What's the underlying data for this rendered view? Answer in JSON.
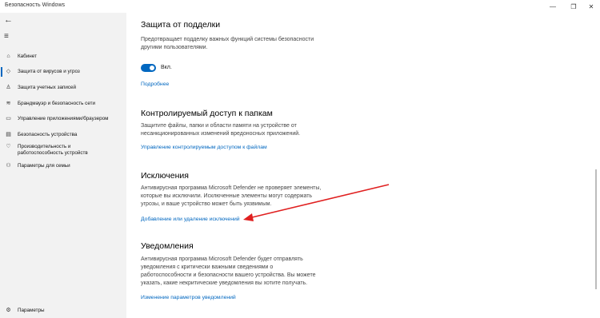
{
  "window": {
    "title": "Безопасность Windows",
    "controls": [
      "—",
      "❐",
      "✕"
    ]
  },
  "sidebar": {
    "back_glyph": "←",
    "menu_glyph": "≡",
    "items": [
      {
        "label": "Кабинет",
        "icon": "home-icon",
        "glyph": "⌂",
        "selected": false
      },
      {
        "label": "Защита от вирусов и угроз",
        "icon": "shield-icon",
        "glyph": "◇",
        "selected": true
      },
      {
        "label": "Защита учетных записей",
        "icon": "person-icon",
        "glyph": "♙",
        "selected": false
      },
      {
        "label": "Брандмауэр и безопасность сети",
        "icon": "wifi-icon",
        "glyph": "≋",
        "selected": false
      },
      {
        "label": "Управление приложениями/браузером",
        "icon": "window-icon",
        "glyph": "▭",
        "selected": false
      },
      {
        "label": "Безопасность устройства",
        "icon": "device-icon",
        "glyph": "▤",
        "selected": false
      },
      {
        "label": "Производительность и работоспособность устройств",
        "icon": "heart-icon",
        "glyph": "♡",
        "selected": false
      },
      {
        "label": "Параметры для семьи",
        "icon": "family-icon",
        "glyph": "⚇",
        "selected": false
      }
    ],
    "settings": {
      "label": "Параметры",
      "icon": "gear-icon",
      "glyph": "⚙"
    }
  },
  "sections": {
    "tamper": {
      "title": "Защита от подделки",
      "desc_lines": [
        "Предотвращает подделку важных функций системы безопасности",
        "другими пользователями."
      ],
      "toggle_label": "Вкл.",
      "link": "Подробнее"
    },
    "folders": {
      "title": "Контролируемый доступ к папкам",
      "desc_lines": [
        "Защитите файлы, папки и области памяти на устройстве от",
        "несанкционированных изменений вредоносных приложений."
      ],
      "link": "Управление контролируемым доступом к файлам"
    },
    "exclusions": {
      "title": "Исключения",
      "desc_lines": [
        "Антивирусная программа Microsoft Defender не проверяет элементы,",
        "которые вы исключили. Исключенные элементы могут содержать",
        "угрозы, и ваше устройство может быть уязвимым."
      ],
      "link": "Добавление или удаление исключений"
    },
    "notifications": {
      "title": "Уведомления",
      "desc_lines": [
        "Антивирусная программа Microsoft Defender будет отправлять",
        "уведомления с критически важными сведениями о",
        "работоспособности и безопасности вашего устройства. Вы можете",
        "указать, какие некритические уведомления вы хотите получать."
      ],
      "link": "Изменение параметров уведомлений"
    }
  },
  "annotation_color": "#e02020",
  "accent_color": "#0067c0"
}
